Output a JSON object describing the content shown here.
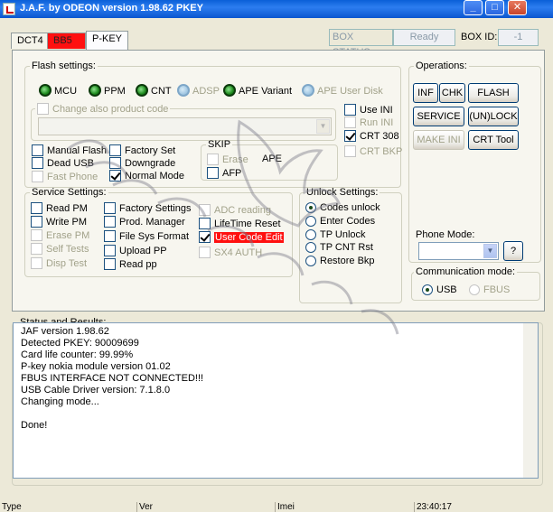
{
  "window": {
    "title": "J.A.F. by ODEON version 1.98.62 PKEY"
  },
  "tabs": [
    {
      "label": "DCT4"
    },
    {
      "label": "BB5"
    },
    {
      "label": "P-KEY"
    }
  ],
  "box_status": {
    "label": "BOX STATUS:",
    "value": "Ready",
    "id_label": "BOX ID:",
    "id_value": "-1"
  },
  "flash_settings": {
    "legend": "Flash settings:",
    "leds": [
      {
        "label": "MCU"
      },
      {
        "label": "PPM"
      },
      {
        "label": "CNT"
      },
      {
        "label": "ADSP"
      },
      {
        "label": "APE Variant"
      },
      {
        "label": "APE User Disk"
      }
    ],
    "change_product": "Change also product code",
    "use_ini": "Use INI",
    "run_ini": "Run INI",
    "crt308": "CRT 308",
    "crt_bkp": "CRT BKP",
    "manual_flash": "Manual Flash",
    "dead_usb": "Dead USB",
    "fast_phone": "Fast Phone",
    "factory_set": "Factory Set",
    "downgrade": "Downgrade",
    "normal_mode": "Normal Mode",
    "skip": {
      "legend": "SKIP",
      "erase": "Erase",
      "ape": "APE",
      "afp": "AFP"
    }
  },
  "operations": {
    "legend": "Operations:",
    "inf": "INF",
    "chk": "CHK",
    "flash": "FLASH",
    "service": "SERVICE",
    "unlock": "(UN)LOCK",
    "make_ini": "MAKE INI",
    "crt_tool": "CRT Tool",
    "phone_mode_legend": "Phone Mode:",
    "help": "?"
  },
  "service_settings": {
    "legend": "Service Settings:",
    "read_pm": "Read PM",
    "write_pm": "Write PM",
    "erase_pm": "Erase PM",
    "self_tests": "Self Tests",
    "disp_test": "Disp Test",
    "factory_settings": "Factory Settings",
    "prod_manager": "Prod. Manager",
    "file_sys_format": "File Sys Format",
    "upload_pp": "Upload PP",
    "read_pp": "Read pp",
    "adc_reading": "ADC reading",
    "lifetime_reset": "LifeTime Reset",
    "user_code_edit": "User Code Edit",
    "sx4_auth": "SX4 AUTH"
  },
  "unlock_settings": {
    "legend": "Unlock Settings:",
    "codes_unlock": "Codes unlock",
    "enter_codes": "Enter Codes",
    "tp_unlock": "TP Unlock",
    "tp_cnt_rst": "TP CNT Rst",
    "restore_bkp": "Restore Bkp"
  },
  "communication": {
    "legend": "Communication mode:",
    "usb": "USB",
    "fbus": "FBUS"
  },
  "status": {
    "legend": "Status and Results:",
    "lines": [
      "JAF version 1.98.62",
      "Detected PKEY: 90009699",
      "Card life counter: 99.99%",
      "P-key nokia module version 01.02",
      "FBUS INTERFACE NOT CONNECTED!!!",
      "USB Cable Driver version: 7.1.8.0",
      "Changing mode...",
      "",
      "Done!"
    ]
  },
  "statusbar": {
    "type": "Type",
    "ver": "Ver",
    "imei": "Imei",
    "time": "23:40:17"
  }
}
